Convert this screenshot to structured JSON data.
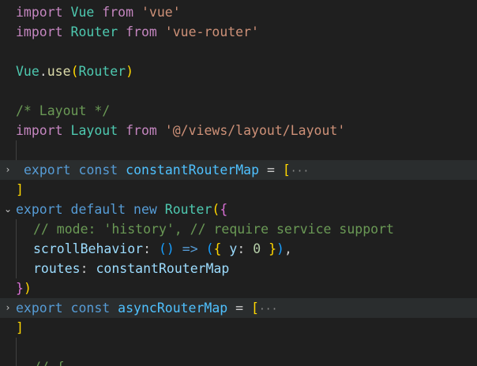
{
  "editor": {
    "language": "javascript",
    "theme_colors": {
      "background": "#1f1f1f",
      "keyword": "#c586c0",
      "storage": "#569cd6",
      "class": "#4ec9b0",
      "string": "#ce9178",
      "function": "#dcdcaa",
      "variable": "#9cdcfe",
      "constant": "#4fc1ff",
      "comment": "#6a9955",
      "number": "#b5cea8",
      "bracket_1": "#ffd700",
      "bracket_2": "#da70d6",
      "bracket_3": "#179fff"
    },
    "fold_icons": {
      "collapsed": "chevron-right-icon",
      "expanded": "chevron-down-icon"
    },
    "lines": {
      "l1": {
        "t1": "import",
        "t2": " ",
        "t3": "Vue",
        "t4": " ",
        "t5": "from",
        "t6": " ",
        "t7": "'vue'"
      },
      "l2": {
        "t1": "import",
        "t2": " ",
        "t3": "Router",
        "t4": " ",
        "t5": "from",
        "t6": " ",
        "t7": "'vue-router'"
      },
      "l4": {
        "t1": "Vue",
        "t2": ".",
        "t3": "use",
        "t4": "(",
        "t5": "Router",
        "t6": ")"
      },
      "l6": {
        "t1": "/* Layout */"
      },
      "l7": {
        "t1": "import",
        "t2": " ",
        "t3": "Layout",
        "t4": " ",
        "t5": "from",
        "t6": " ",
        "t7": "'@/views/layout/Layout'"
      },
      "l9": {
        "fold": "›",
        "t1": "export",
        "t2": " ",
        "t3": "const",
        "t4": " ",
        "t5": "constantRouterMap",
        "t6": " = ",
        "t7": "[",
        "t8": "···"
      },
      "l10": {
        "t1": "]"
      },
      "l11": {
        "fold": "⌄",
        "t1": "export",
        "t2": " ",
        "t3": "default",
        "t4": " ",
        "t5": "new",
        "t6": " ",
        "t7": "Router",
        "t8": "(",
        "t9": "{"
      },
      "l12": {
        "t1": "// mode: 'history', // require service support"
      },
      "l13": {
        "t1": "scrollBehavior",
        "t2": ": ",
        "t3": "()",
        "t4": " ",
        "t5": "=>",
        "t6": " ",
        "t7": "(",
        "t8": "{",
        "t9": " ",
        "t10": "y",
        "t11": ": ",
        "t12": "0",
        "t13": " ",
        "t14": "}",
        "t15": ")",
        "t16": ","
      },
      "l14": {
        "t1": "routes",
        "t2": ": ",
        "t3": "constantRouterMap"
      },
      "l15": {
        "t1": "}",
        "t2": ")"
      },
      "l16": {
        "fold": "›",
        "t1": "export",
        "t2": " ",
        "t3": "const",
        "t4": " ",
        "t5": "asyncRouterMap",
        "t6": " = ",
        "t7": "[",
        "t8": "···"
      },
      "l17": {
        "t1": "]"
      },
      "l19": {
        "t1": "// {"
      }
    }
  }
}
